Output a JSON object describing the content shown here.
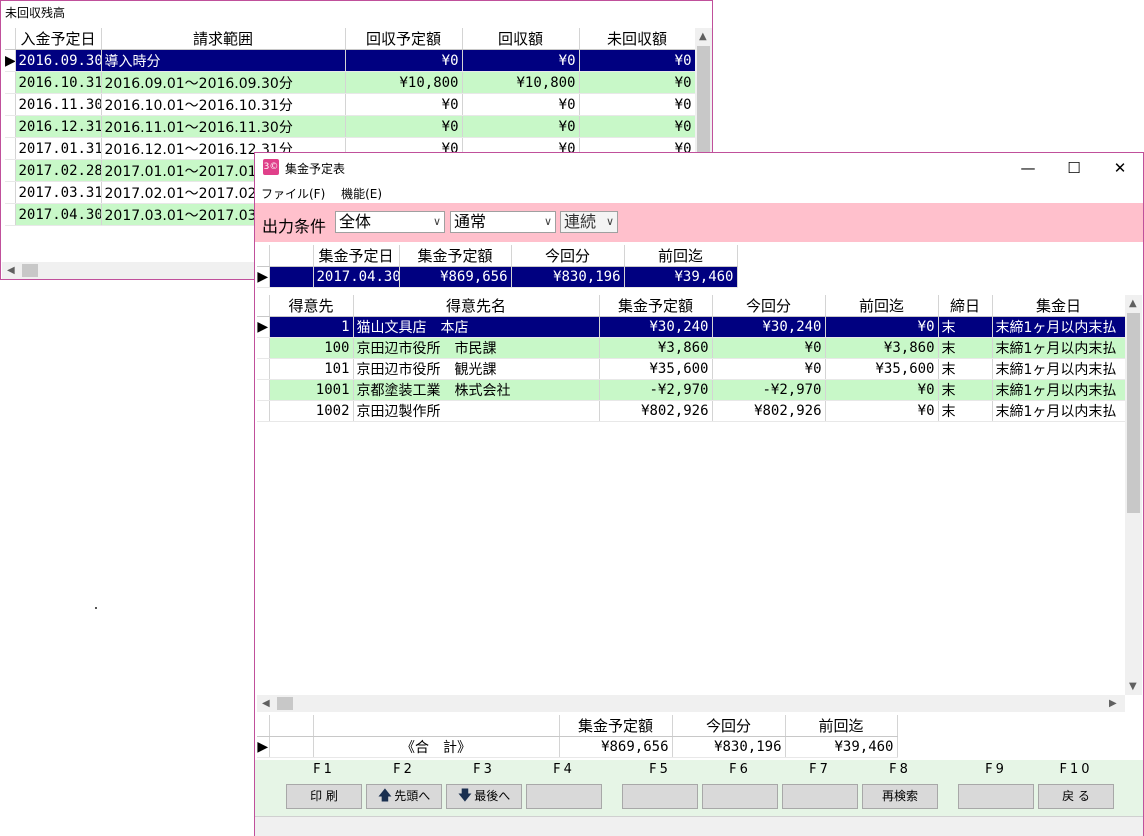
{
  "back_window": {
    "title": "未回収残高",
    "columns": [
      "入金予定日",
      "請求範囲",
      "回収予定額",
      "回収額",
      "未回収額"
    ],
    "rows": [
      {
        "date": "2016.09.30",
        "range": "導入時分",
        "planned": "¥0",
        "collected": "¥0",
        "uncollected": "¥0"
      },
      {
        "date": "2016.10.31",
        "range": "2016.09.01～2016.09.30分",
        "planned": "¥10,800",
        "collected": "¥10,800",
        "uncollected": "¥0"
      },
      {
        "date": "2016.11.30",
        "range": "2016.10.01～2016.10.31分",
        "planned": "¥0",
        "collected": "¥0",
        "uncollected": "¥0"
      },
      {
        "date": "2016.12.31",
        "range": "2016.11.01～2016.11.30分",
        "planned": "¥0",
        "collected": "¥0",
        "uncollected": "¥0"
      },
      {
        "date": "2017.01.31",
        "range": "2016.12.01～2016.12.31分",
        "planned": "¥0",
        "collected": "¥0",
        "uncollected": "¥0"
      },
      {
        "date": "2017.02.28",
        "range": "2017.01.01～2017.01",
        "planned": "",
        "collected": "",
        "uncollected": ""
      },
      {
        "date": "2017.03.31",
        "range": "2017.02.01～2017.02",
        "planned": "",
        "collected": "",
        "uncollected": ""
      },
      {
        "date": "2017.04.30",
        "range": "2017.03.01～2017.03",
        "planned": "",
        "collected": "",
        "uncollected": ""
      }
    ]
  },
  "front_window": {
    "title": "集金予定表",
    "icon_text": "3©",
    "controls": {
      "minimize": "—",
      "maximize": "☐",
      "close": "✕"
    },
    "menu": [
      "ファイル(F)",
      "機能(E)"
    ],
    "condition_label": "出力条件",
    "dropdowns": [
      {
        "value": "全体"
      },
      {
        "value": "通常"
      },
      {
        "value": "連続"
      }
    ],
    "summary": {
      "columns": [
        "集金予定日",
        "集金予定額",
        "今回分",
        "前回迄"
      ],
      "row": {
        "date": "2017.04.30",
        "amount": "¥869,656",
        "current": "¥830,196",
        "previous": "¥39,460"
      }
    },
    "main": {
      "columns": [
        "得意先",
        "得意先名",
        "集金予定額",
        "今回分",
        "前回迄",
        "締日",
        "集金日"
      ],
      "rows": [
        {
          "code": "1",
          "name": "猫山文具店　本店",
          "amount": "¥30,240",
          "current": "¥30,240",
          "previous": "¥0",
          "closing": "末",
          "collect": "末締1ヶ月以内末払"
        },
        {
          "code": "100",
          "name": "京田辺市役所　市民課",
          "amount": "¥3,860",
          "current": "¥0",
          "previous": "¥3,860",
          "closing": "末",
          "collect": "末締1ヶ月以内末払"
        },
        {
          "code": "101",
          "name": "京田辺市役所　観光課",
          "amount": "¥35,600",
          "current": "¥0",
          "previous": "¥35,600",
          "closing": "末",
          "collect": "末締1ヶ月以内末払"
        },
        {
          "code": "1001",
          "name": "京都塗装工業　株式会社",
          "amount": "-¥2,970",
          "current": "-¥2,970",
          "previous": "¥0",
          "closing": "末",
          "collect": "末締1ヶ月以内末払"
        },
        {
          "code": "1002",
          "name": "京田辺製作所",
          "amount": "¥802,926",
          "current": "¥802,926",
          "previous": "¥0",
          "closing": "末",
          "collect": "末締1ヶ月以内末払"
        }
      ]
    },
    "total": {
      "columns": [
        "集金予定額",
        "今回分",
        "前回迄"
      ],
      "label": "《合　計》",
      "amount": "¥869,656",
      "current": "¥830,196",
      "previous": "¥39,460"
    },
    "fkeys": [
      {
        "key": "F1",
        "label": "印 刷",
        "icon": ""
      },
      {
        "key": "F2",
        "label": "先頭へ",
        "icon": "up-arrow-icon"
      },
      {
        "key": "F3",
        "label": "最後へ",
        "icon": "down-arrow-icon"
      },
      {
        "key": "F4",
        "label": "",
        "icon": ""
      },
      {
        "key": "F5",
        "label": "",
        "icon": ""
      },
      {
        "key": "F6",
        "label": "",
        "icon": ""
      },
      {
        "key": "F7",
        "label": "",
        "icon": ""
      },
      {
        "key": "F8",
        "label": "再検索",
        "icon": ""
      },
      {
        "key": "F9",
        "label": "",
        "icon": ""
      },
      {
        "key": "F10",
        "label": "戻 る",
        "icon": ""
      }
    ]
  },
  "colors": {
    "selected_row": "#000080",
    "alt_row": "#c8f8c8",
    "condition_bar": "#ffc0cc",
    "window_border": "#c0509b",
    "fkey_area": "#e6f5e6"
  }
}
